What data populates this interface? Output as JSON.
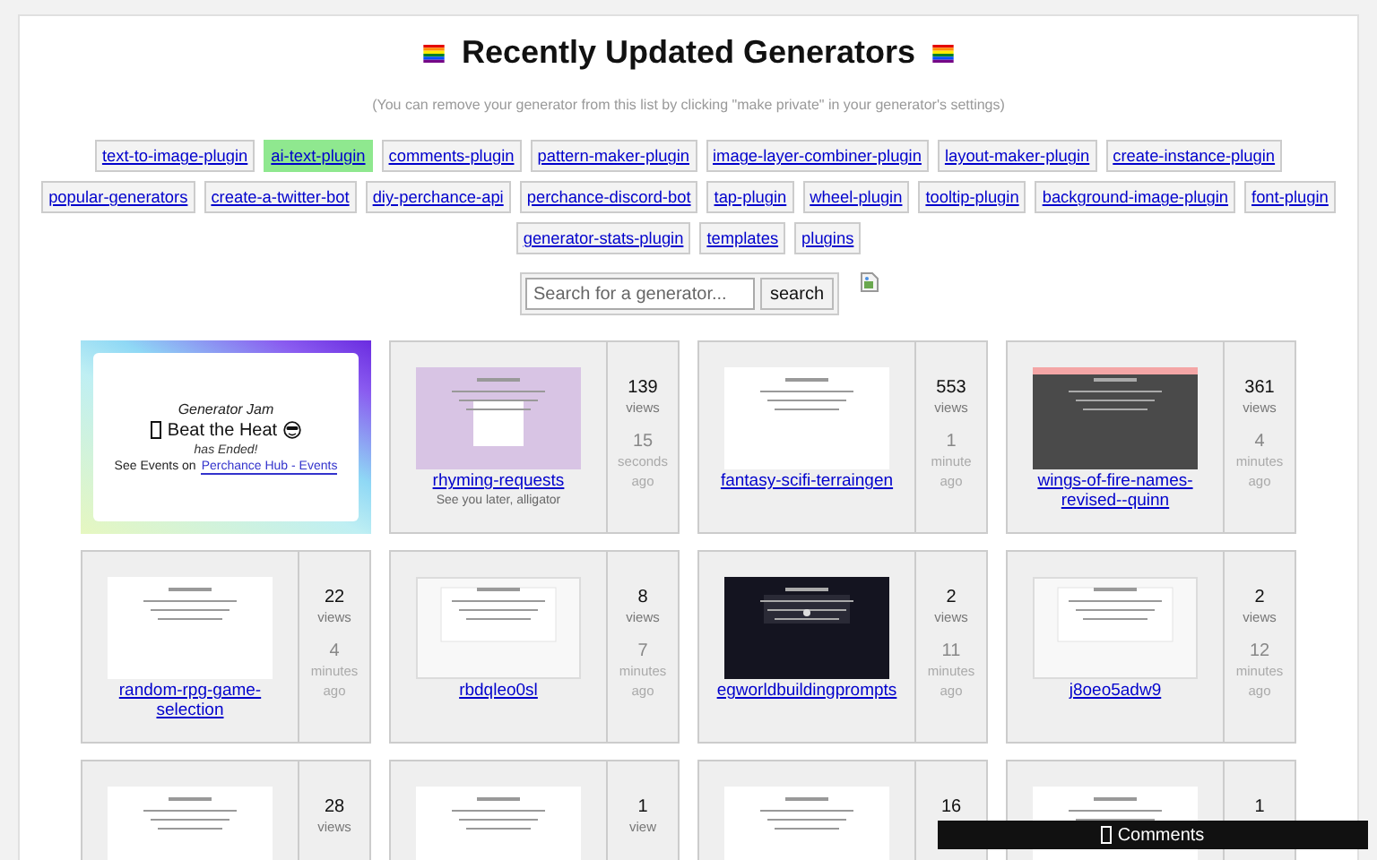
{
  "title": "Recently Updated Generators",
  "note": "(You can remove your generator from this list by clicking \"make private\" in your generator's settings)",
  "tags": [
    {
      "label": "text-to-image-plugin",
      "selected": false
    },
    {
      "label": "ai-text-plugin",
      "selected": true
    },
    {
      "label": "comments-plugin",
      "selected": false
    },
    {
      "label": "pattern-maker-plugin",
      "selected": false
    },
    {
      "label": "image-layer-combiner-plugin",
      "selected": false
    },
    {
      "label": "layout-maker-plugin",
      "selected": false
    },
    {
      "label": "create-instance-plugin",
      "selected": false
    },
    {
      "label": "popular-generators",
      "selected": false
    },
    {
      "label": "create-a-twitter-bot",
      "selected": false
    },
    {
      "label": "diy-perchance-api",
      "selected": false
    },
    {
      "label": "perchance-discord-bot",
      "selected": false
    },
    {
      "label": "tap-plugin",
      "selected": false
    },
    {
      "label": "wheel-plugin",
      "selected": false
    },
    {
      "label": "tooltip-plugin",
      "selected": false
    },
    {
      "label": "background-image-plugin",
      "selected": false
    },
    {
      "label": "font-plugin",
      "selected": false
    },
    {
      "label": "generator-stats-plugin",
      "selected": false
    },
    {
      "label": "templates",
      "selected": false
    },
    {
      "label": "plugins",
      "selected": false
    }
  ],
  "search": {
    "placeholder": "Search for a generator...",
    "button": "search"
  },
  "event": {
    "heading": "Generator Jam",
    "name": "Beat the Heat",
    "status": "has Ended!",
    "lead": "See Events on",
    "link": "Perchance Hub - Events"
  },
  "generators": [
    {
      "name": "rhyming-requests",
      "subtitle": "See you later, alligator",
      "thumbnail": {
        "kind": "lilac"
      },
      "views": "139",
      "views_label": "views",
      "time": "15",
      "time_unit": "seconds",
      "ago": "ago"
    },
    {
      "name": "fantasy-scifi-terraingen",
      "thumbnail": {
        "kind": "light"
      },
      "views": "553",
      "views_label": "views",
      "time": "1",
      "time_unit": "minute",
      "ago": "ago"
    },
    {
      "name": "wings-of-fire-names-revised--quinn",
      "thumbnail": {
        "kind": "banner"
      },
      "views": "361",
      "views_label": "views",
      "time": "4",
      "time_unit": "minutes",
      "ago": "ago"
    },
    {
      "name": "random-rpg-game-selection",
      "thumbnail": {
        "kind": "light"
      },
      "views": "22",
      "views_label": "views",
      "time": "4",
      "time_unit": "minutes",
      "ago": "ago"
    },
    {
      "name": "rbdqleo0sl",
      "thumbnail": {
        "kind": "boxed"
      },
      "views": "8",
      "views_label": "views",
      "time": "7",
      "time_unit": "minutes",
      "ago": "ago"
    },
    {
      "name": "egworldbuildingprompts",
      "thumbnail": {
        "kind": "dark"
      },
      "views": "2",
      "views_label": "views",
      "time": "11",
      "time_unit": "minutes",
      "ago": "ago"
    },
    {
      "name": "j8oeo5adw9",
      "thumbnail": {
        "kind": "boxed"
      },
      "views": "2",
      "views_label": "views",
      "time": "12",
      "time_unit": "minutes",
      "ago": "ago"
    },
    {
      "thumbnail": {
        "kind": "light"
      },
      "views": "28",
      "views_label": "views"
    },
    {
      "thumbnail": {
        "kind": "light"
      },
      "views": "1",
      "views_label": "view"
    },
    {
      "thumbnail": {
        "kind": "light"
      },
      "views": "16"
    },
    {
      "thumbnail": {
        "kind": "light"
      },
      "views": "1"
    }
  ],
  "comments": {
    "label": "Comments"
  }
}
